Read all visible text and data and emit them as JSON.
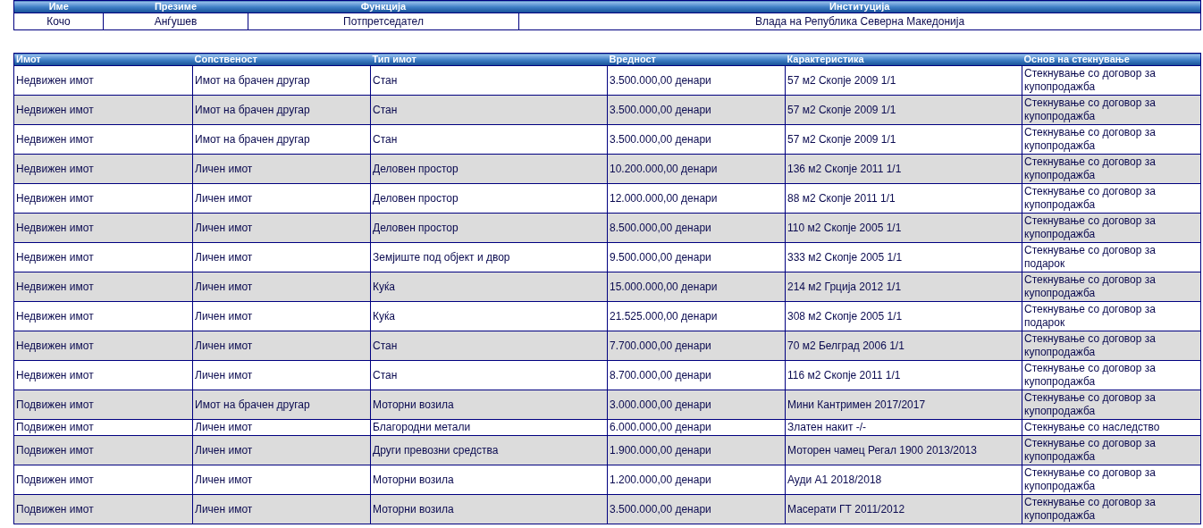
{
  "person_table": {
    "columns": [
      "Име",
      "Презиме",
      "Функција",
      "Институција"
    ],
    "row": [
      "Кочо",
      "Анѓушев",
      "Потпретседател",
      "Влада на Република Северна Македонија"
    ]
  },
  "assets_table": {
    "columns": [
      "Имот",
      "Сопственост",
      "Тип имот",
      "Вредност",
      "Карактеристика",
      "Основ на стекнување"
    ],
    "rows": [
      [
        "Недвижен имот",
        "Имот на брачен другар",
        "Стан",
        "3.500.000,00 денари",
        "57 м2 Скопје 2009 1/1",
        "Стекнување со договор за купопродажба"
      ],
      [
        "Недвижен имот",
        "Имот на брачен другар",
        "Стан",
        "3.500.000,00 денари",
        "57 м2 Скопје 2009 1/1",
        "Стекнување со договор за купопродажба"
      ],
      [
        "Недвижен имот",
        "Имот на брачен другар",
        "Стан",
        "3.500.000,00 денари",
        "57 м2 Скопје 2009 1/1",
        "Стекнување со договор за купопродажба"
      ],
      [
        "Недвижен имот",
        "Личен имот",
        "Деловен простор",
        "10.200.000,00 денари",
        "136 м2 Скопје 2011 1/1",
        "Стекнување со договор за купопродажба"
      ],
      [
        "Недвижен имот",
        "Личен имот",
        "Деловен простор",
        "12.000.000,00 денари",
        "88 м2 Скопје 2011 1/1",
        "Стекнување со договор за купопродажба"
      ],
      [
        "Недвижен имот",
        "Личен имот",
        "Деловен простор",
        "8.500.000,00 денари",
        "110 м2 Скопје 2005 1/1",
        "Стекнување со договор за купопродажба"
      ],
      [
        "Недвижен имот",
        "Личен имот",
        "Земјиште под објект и двор",
        "9.500.000,00 денари",
        "333 м2 Скопје 2005 1/1",
        "Стекнување со договор за подарок"
      ],
      [
        "Недвижен имот",
        "Личен имот",
        "Куќа",
        "15.000.000,00 денари",
        "214 м2 Грција 2012 1/1",
        "Стекнување со договор за купопродажба"
      ],
      [
        "Недвижен имот",
        "Личен имот",
        "Куќа",
        "21.525.000,00 денари",
        "308 м2 Скопје 2005 1/1",
        "Стекнување со договор за подарок"
      ],
      [
        "Недвижен имот",
        "Личен имот",
        "Стан",
        "7.700.000,00 денари",
        "70 м2 Белград 2006 1/1",
        "Стекнување со договор за купопродажба"
      ],
      [
        "Недвижен имот",
        "Личен имот",
        "Стан",
        "8.700.000,00 денари",
        "116 м2 Скопје 2011 1/1",
        "Стекнување со договор за купопродажба"
      ],
      [
        "Подвижен имот",
        "Имот на брачен другар",
        "Моторни возила",
        "3.000.000,00 денари",
        "Мини Кантримен 2017/2017",
        "Стекнување со договор за купопродажба"
      ],
      [
        "Подвижен имот",
        "Личен имот",
        "Благородни метали",
        "6.000.000,00 денари",
        "Златен накит -/-",
        "Стекнување со наследство"
      ],
      [
        "Подвижен имот",
        "Личен имот",
        "Други превозни средства",
        "1.900.000,00 денари",
        "Моторен чамец Регал 1900 2013/2013",
        "Стекнување со договор за купопродажба"
      ],
      [
        "Подвижен имот",
        "Личен имот",
        "Моторни возила",
        "1.200.000,00 денари",
        "Ауди А1 2018/2018",
        "Стекнување со договор за купопродажба"
      ],
      [
        "Подвижен имот",
        "Личен имот",
        "Моторни возила",
        "3.500.000,00 денари",
        "Масерати ГТ 2011/2012",
        "Стекнување со договор за купопродажба"
      ]
    ]
  }
}
